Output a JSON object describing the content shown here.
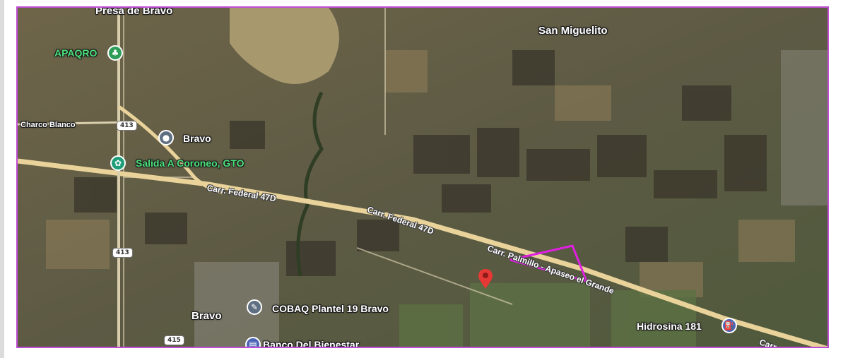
{
  "map": {
    "type": "satellite",
    "place_labels": {
      "presa": "Presa de Bravo",
      "apaqro": "APAQRO",
      "san_miguelito": "San Miguelito",
      "charco_blanco": "Charco Blanco",
      "bravo_poi": "Bravo",
      "salida": "Salida A Coroneo, GTO",
      "bravo_town": "Bravo",
      "cobaq": "COBAQ Plantel 19 Bravo",
      "banco": "Banco Del Bienestar",
      "hidrosina": "Hidrosina 181"
    },
    "road_labels": {
      "federal_1": "Carr. Federal 47D",
      "federal_2": "Carr. Federal 47D",
      "palmillo": "Carr. Palmillo - Apaseo el Grande",
      "carr_edge": "Carr."
    },
    "shields": {
      "s413_a": "413",
      "s413_b": "413",
      "s415": "415"
    },
    "icons": {
      "apaqro": "tree-icon",
      "bravo": "pin-icon",
      "salida": "flower-icon",
      "cobaq": "school-icon",
      "banco": "bank-icon",
      "hidrosina": "fuel-icon",
      "marker": "location-marker-icon"
    },
    "colors": {
      "frame_border": "#c04dd6",
      "parcel_outline": "#e020e0",
      "marker": "#e53935",
      "highway": "#e9d39a"
    }
  }
}
